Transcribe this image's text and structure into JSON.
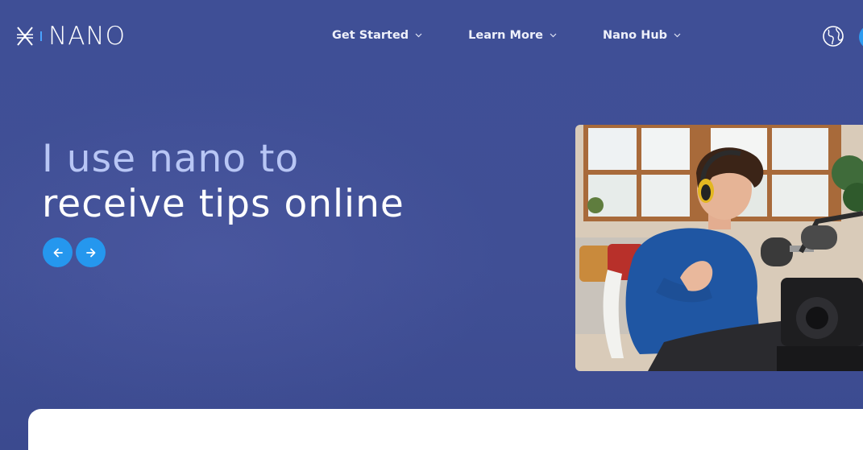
{
  "brand": {
    "logo_text": "NANO",
    "logo_icon": "nano-x-icon"
  },
  "nav": {
    "items": [
      {
        "label": "Get Started",
        "icon": "chevron-down-icon"
      },
      {
        "label": "Learn More",
        "icon": "chevron-down-icon"
      },
      {
        "label": "Nano Hub",
        "icon": "chevron-down-icon"
      }
    ],
    "language_icon": "globe-icon"
  },
  "hero": {
    "line1": "I use nano to",
    "line2": "receive tips online",
    "prev_icon": "arrow-left-icon",
    "next_icon": "arrow-right-icon",
    "image": "photo of young man with headphones talking into a microphone"
  },
  "colors": {
    "background": "#3f4f95",
    "accent": "#2597ee",
    "headline_light": "#b8c6f5",
    "headline": "#ffffff",
    "card": "#ffffff"
  }
}
